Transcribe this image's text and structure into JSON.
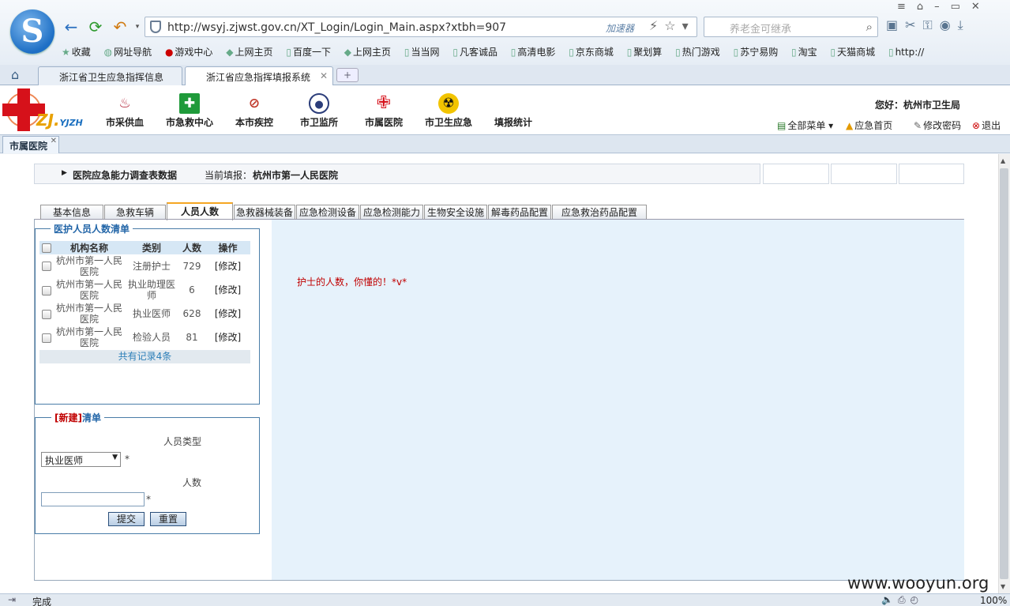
{
  "browser": {
    "url": "http://wsyj.zjwst.gov.cn/XT_Login/Login_Main.aspx?xtbh=907",
    "accelerator": "加速器",
    "search_placeholder": "养老金可继承",
    "bookmarks": [
      "收藏",
      "网址导航",
      "游戏中心",
      "上网主页",
      "百度一下",
      "上网主页",
      "当当网",
      "凡客诚品",
      "高清电影",
      "京东商城",
      "聚划算",
      "热门游戏",
      "苏宁易购",
      "淘宝",
      "天猫商城",
      "http://"
    ],
    "tabs": [
      "浙江省卫生应急指挥信息",
      "浙江省应急指挥填报系统"
    ],
    "status": "完成",
    "zoom": "100%",
    "watermark": "www.wooyun.org"
  },
  "header": {
    "logo_text": "ZJ.",
    "logo_sub": "YJZH",
    "modules": [
      "市采供血",
      "市急救中心",
      "本市疾控",
      "市卫监所",
      "市属医院",
      "市卫生应急",
      "填报统计"
    ],
    "greeting": "您好：杭州市卫生局",
    "links": [
      "全部菜单",
      "应急首页",
      "修改密码",
      "退出"
    ]
  },
  "page_tab": "市属医院",
  "info_bar": {
    "title": "医院应急能力调查表数据",
    "current_label": "当前填报：",
    "hospital": "杭州市第一人民医院"
  },
  "data_tabs": [
    "基本信息",
    "急救车辆",
    "人员人数",
    "急救器械装备",
    "应急检测设备",
    "应急检测能力",
    "生物安全设施",
    "解毒药品配置",
    "应急救治药品配置"
  ],
  "list": {
    "legend": "医护人员人数清单",
    "columns": [
      "机构名称",
      "类别",
      "人数",
      "操作"
    ],
    "rows": [
      {
        "org": "杭州市第一人民医院",
        "type": "注册护士",
        "count": "729",
        "op": "[修改]"
      },
      {
        "org": "杭州市第一人民医院",
        "type": "执业助理医师",
        "count": "6",
        "op": "[修改]"
      },
      {
        "org": "杭州市第一人民医院",
        "type": "执业医师",
        "count": "628",
        "op": "[修改]"
      },
      {
        "org": "杭州市第一人民医院",
        "type": "检验人员",
        "count": "81",
        "op": "[修改]"
      }
    ],
    "total": "共有记录4条"
  },
  "form": {
    "legend_new": "[新建]",
    "legend_rest": "清单",
    "type_label": "人员类型",
    "type_value": "执业医师",
    "count_label": "人数",
    "count_value": "",
    "required": "*",
    "submit": "提交",
    "reset": "重置"
  },
  "message": "护士的人数，你懂的！*v*",
  "colors": {
    "accent": "#2366a8",
    "alert": "#c00000",
    "brand_red": "#d6111a",
    "pane_bg": "#e6f2fb"
  }
}
